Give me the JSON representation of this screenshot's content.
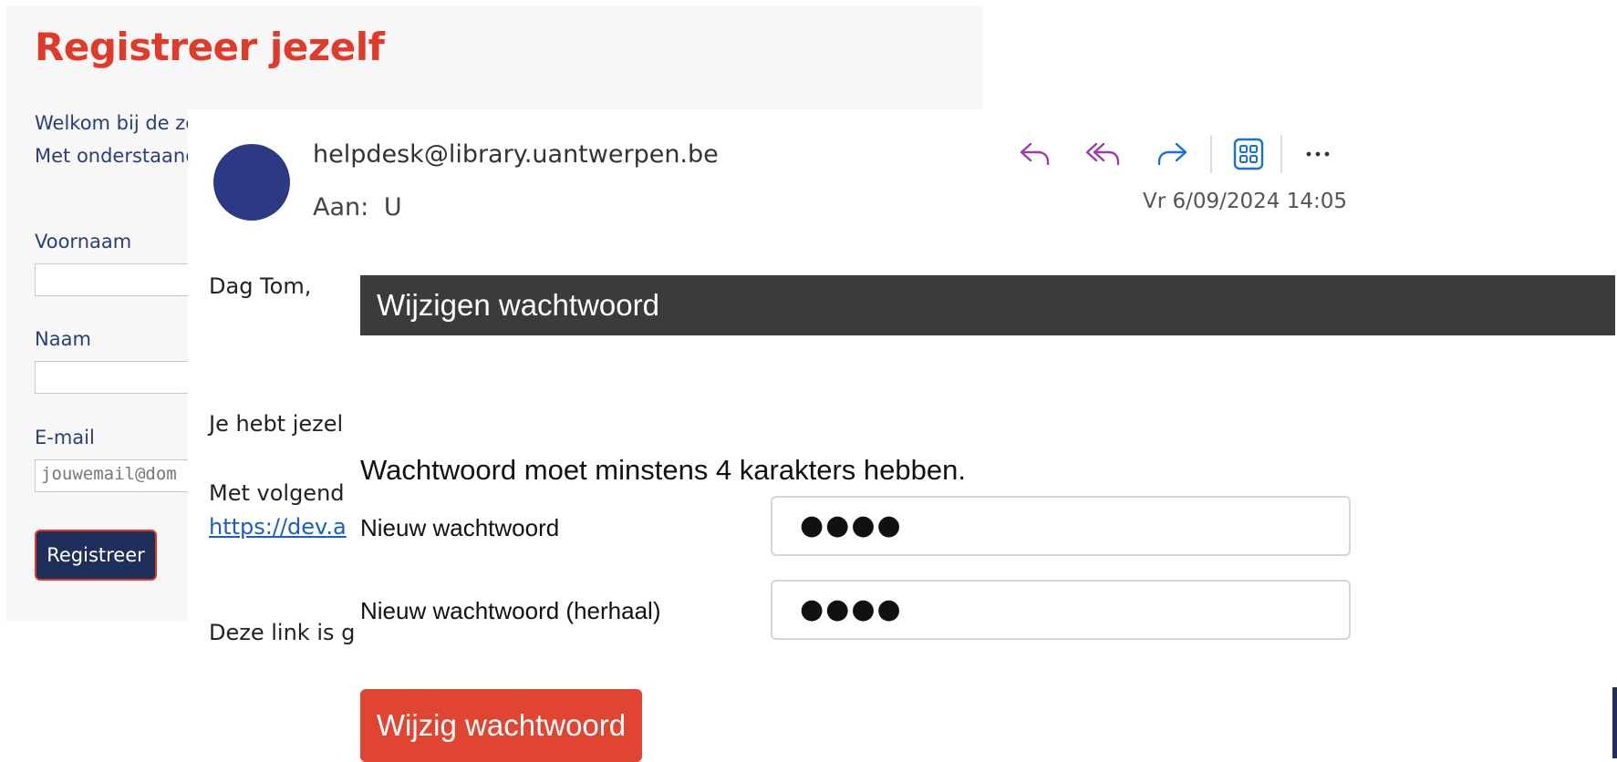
{
  "registration": {
    "title": "Registreer jezelf",
    "intro_line1": "Welkom bij de ze",
    "intro_line2": "Met onderstaand",
    "firstname_label": "Voornaam",
    "lastname_label": "Naam",
    "email_label": "E-mail",
    "email_placeholder": "jouwemail@dom",
    "register_button": "Registreer"
  },
  "email": {
    "from": "helpdesk@library.uantwerpen.be",
    "to_label": "Aan:",
    "to_value": "U",
    "date": "Vr 6/09/2024 14:05",
    "toolbar": {
      "icons": [
        "reply-icon",
        "reply-all-icon",
        "forward-icon",
        "apps-icon",
        "more-icon"
      ]
    },
    "body": {
      "greeting": "Dag Tom,",
      "line1": "Je hebt jezel",
      "line2": "Met volgend",
      "link": "https://dev.a",
      "line3": "Deze link is g"
    },
    "colors": {
      "avatar": "#2c3a84",
      "reply_icons": "#9b3ca8",
      "forward_icon": "#1a6fd0"
    }
  },
  "password_form": {
    "header": "Wijzigen wachtwoord",
    "requirement": "Wachtwoord moet minstens 4 karakters hebben.",
    "new_label": "Nieuw wachtwoord",
    "new_value": "●●●●",
    "repeat_label": "Nieuw wachtwoord (herhaal)",
    "repeat_value": "●●●●",
    "submit_button": "Wijzig wachtwoord",
    "colors": {
      "header_bg": "#3b3b3b",
      "button_bg": "#e04532"
    }
  }
}
